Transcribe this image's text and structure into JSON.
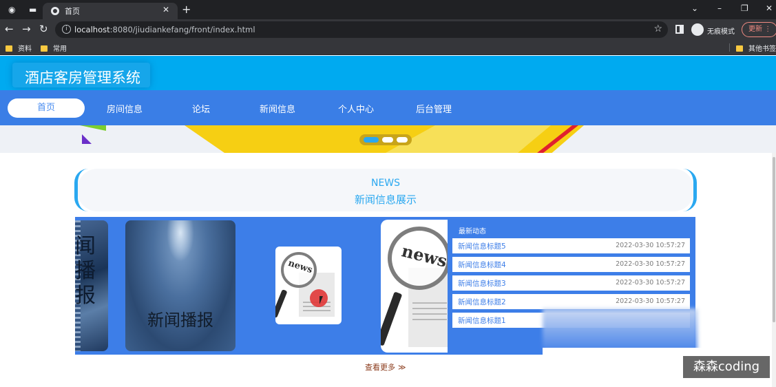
{
  "browser": {
    "tab_title": "首页",
    "url_host": "localhost",
    "url_rest": ":8080/jiudiankefang/front/index.html",
    "incognito_label": "无痕模式",
    "update_label": "更新",
    "bookmarks": [
      "资料",
      "常用"
    ],
    "other_bookmarks": "其他书签"
  },
  "site": {
    "title": "酒店客房管理系统",
    "nav": [
      "首页",
      "房间信息",
      "论坛",
      "新闻信息",
      "个人中心",
      "后台管理"
    ],
    "active_nav": "首页"
  },
  "news": {
    "heading_en": "NEWS",
    "heading_cn": "新闻信息展示",
    "card_left_text": "闻播报",
    "card_mid_text": "新闻播报",
    "lens_small_text": "news",
    "lens_big_text": "news",
    "latest_title": "最新动态",
    "items": [
      {
        "title": "新闻信息标题5",
        "date": "2022-03-30 10:57:27"
      },
      {
        "title": "新闻信息标题4",
        "date": "2022-03-30 10:57:27"
      },
      {
        "title": "新闻信息标题3",
        "date": "2022-03-30 10:57:27"
      },
      {
        "title": "新闻信息标题2",
        "date": "2022-03-30 10:57:27"
      },
      {
        "title": "新闻信息标题1",
        "date": ""
      }
    ],
    "more_label": "查看更多",
    "more_arrow": "≫"
  },
  "watermark": "森森coding",
  "colors": {
    "header": "#00aaf0",
    "nav": "#3a7ee6",
    "news_panel": "#3d7ee8",
    "accent": "#2aa8f0"
  }
}
